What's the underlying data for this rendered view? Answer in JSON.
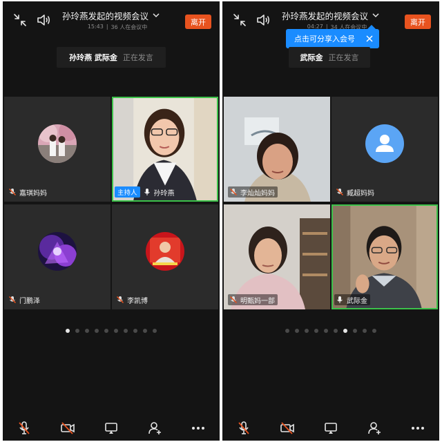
{
  "left": {
    "header": {
      "title": "孙玲燕发起的视频会议",
      "time": "15:43",
      "separator": "|",
      "attendance": "36 人在会议中",
      "leave_label": "离开"
    },
    "speaking": {
      "names": "孙玲燕 武际金",
      "status": "正在发言"
    },
    "tiles": [
      {
        "name": "嘉琪妈妈"
      },
      {
        "name": "孙玲燕",
        "host_label": "主持人"
      },
      {
        "name": "门鹏泽"
      },
      {
        "name": "李凯博"
      }
    ],
    "pagination": {
      "total": 10,
      "current": 1
    }
  },
  "right": {
    "header": {
      "title": "孙玲燕发起的视频会议",
      "time": "04:27",
      "separator": "|",
      "attendance": "34 人在会议中",
      "leave_label": "离开"
    },
    "tooltip": "点击可分享入会号",
    "speaking": {
      "names": "武际金",
      "status": "正在发言"
    },
    "tiles": [
      {
        "name": "李灿灿妈妈"
      },
      {
        "name": "臧超妈妈"
      },
      {
        "name": "明甄妈一部"
      },
      {
        "name": "武际金"
      }
    ],
    "pagination": {
      "total": 10,
      "current": 7
    }
  },
  "colors": {
    "leave": "#e8531f",
    "accent_blue": "#1a8cff",
    "active_border": "#3cc24a",
    "muted_red": "#e8531f"
  }
}
